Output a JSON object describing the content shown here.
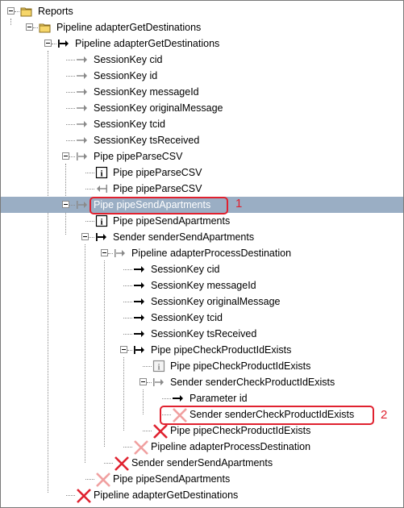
{
  "tree": {
    "rows": [
      {
        "label": "Reports",
        "icon": "folder-icon"
      },
      {
        "label": "Pipeline adapterGetDestinations",
        "icon": "folder-icon"
      },
      {
        "label": "Pipeline adapterGetDestinations",
        "icon": "arrow-start-icon"
      },
      {
        "label": "SessionKey cid",
        "icon": "gray-arrow-icon"
      },
      {
        "label": "SessionKey id",
        "icon": "gray-arrow-icon"
      },
      {
        "label": "SessionKey messageId",
        "icon": "gray-arrow-icon"
      },
      {
        "label": "SessionKey originalMessage",
        "icon": "gray-arrow-icon"
      },
      {
        "label": "SessionKey tcid",
        "icon": "gray-arrow-icon"
      },
      {
        "label": "SessionKey tsReceived",
        "icon": "gray-arrow-icon"
      },
      {
        "label": "Pipe pipeParseCSV",
        "icon": "gray-arrow-start-icon"
      },
      {
        "label": "Pipe pipeParseCSV",
        "icon": "info-icon"
      },
      {
        "label": "Pipe pipeParseCSV",
        "icon": "return-arrow-icon"
      },
      {
        "label": "Pipe pipeSendApartments",
        "icon": "gray-arrow-start-icon"
      },
      {
        "label": "Pipe pipeSendApartments",
        "icon": "info-icon"
      },
      {
        "label": "Sender senderSendApartments",
        "icon": "arrow-start-icon"
      },
      {
        "label": "Pipeline adapterProcessDestination",
        "icon": "gray-arrow-start-icon"
      },
      {
        "label": "SessionKey cid",
        "icon": "black-arrow-icon"
      },
      {
        "label": "SessionKey messageId",
        "icon": "black-arrow-icon"
      },
      {
        "label": "SessionKey originalMessage",
        "icon": "black-arrow-icon"
      },
      {
        "label": "SessionKey tcid",
        "icon": "black-arrow-icon"
      },
      {
        "label": "SessionKey tsReceived",
        "icon": "black-arrow-icon"
      },
      {
        "label": "Pipe pipeCheckProductIdExists",
        "icon": "arrow-start-icon"
      },
      {
        "label": "Pipe pipeCheckProductIdExists",
        "icon": "info-gray-icon"
      },
      {
        "label": "Sender senderCheckProductIdExists",
        "icon": "gray-arrow-start-icon"
      },
      {
        "label": "Parameter id",
        "icon": "black-arrow-icon"
      },
      {
        "label": "Sender senderCheckProductIdExists",
        "icon": "light-x-icon"
      },
      {
        "label": "Pipe pipeCheckProductIdExists",
        "icon": "red-x-icon"
      },
      {
        "label": "Pipeline adapterProcessDestination",
        "icon": "light-x-icon"
      },
      {
        "label": "Sender senderSendApartments",
        "icon": "red-x-icon"
      },
      {
        "label": "Pipe pipeSendApartments",
        "icon": "light-x-icon"
      },
      {
        "label": "Pipeline adapterGetDestinations",
        "icon": "red-x-icon"
      }
    ]
  },
  "annotations": {
    "marker_1": "1",
    "marker_2": "2",
    "color": "#e0212f"
  },
  "selection_color": "#9aaec4"
}
